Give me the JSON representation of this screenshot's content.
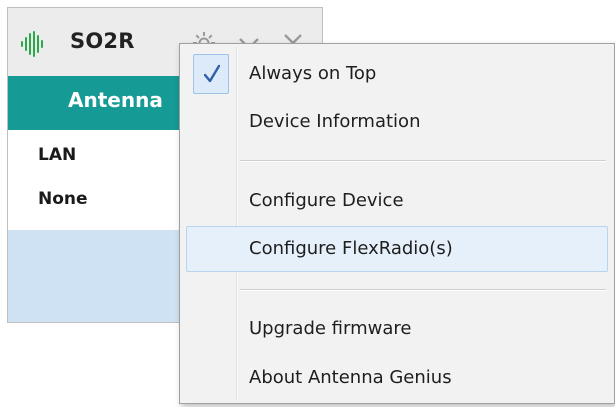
{
  "app": {
    "title": "SO2R",
    "antenna_bar_text": "Antenna",
    "rows": [
      "LAN",
      "None"
    ],
    "colors": {
      "accent_teal": "#169a95",
      "lower_panel_blue": "#cfe2f3"
    },
    "icons": {
      "logo": "waveform-icon",
      "settings": "gear-icon",
      "collapse": "chevron-down-icon",
      "close": "close-icon"
    }
  },
  "menu": {
    "items": [
      {
        "label": "Always on Top",
        "checked": true
      },
      {
        "label": "Device Information"
      },
      {
        "label": "Configure Device"
      },
      {
        "label": "Configure FlexRadio(s)",
        "highlighted": true
      },
      {
        "label": "Upgrade firmware"
      },
      {
        "label": "About Antenna Genius"
      }
    ]
  }
}
